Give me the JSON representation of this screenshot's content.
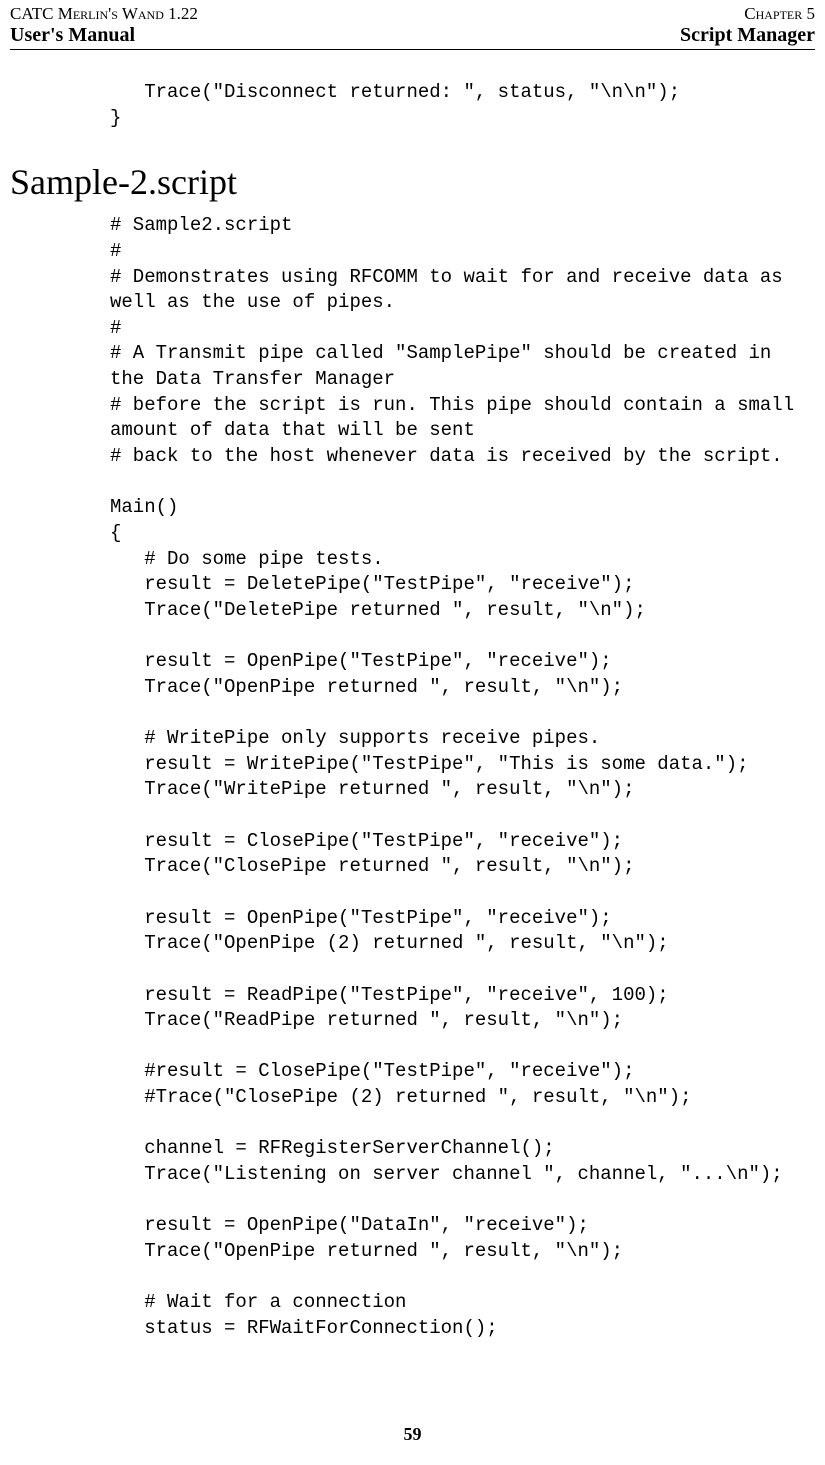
{
  "header": {
    "topLeft": "CATC Merlin's Wand 1.22",
    "topRight": "Chapter 5",
    "bottomLeft": "User's Manual",
    "bottomRight": "Script Manager"
  },
  "codeTop": "   Trace(\"Disconnect returned: \", status, \"\\n\\n\");\n}",
  "heading": "Sample-2.script",
  "codeMain": "# Sample2.script\n#\n# Demonstrates using RFCOMM to wait for and receive data as\nwell as the use of pipes.\n#\n# A Transmit pipe called \"SamplePipe\" should be created in\nthe Data Transfer Manager\n# before the script is run. This pipe should contain a small\namount of data that will be sent\n# back to the host whenever data is received by the script.\n\nMain()\n{\n   # Do some pipe tests.\n   result = DeletePipe(\"TestPipe\", \"receive\");\n   Trace(\"DeletePipe returned \", result, \"\\n\");\n\n   result = OpenPipe(\"TestPipe\", \"receive\");\n   Trace(\"OpenPipe returned \", result, \"\\n\");\n\n   # WritePipe only supports receive pipes.\n   result = WritePipe(\"TestPipe\", \"This is some data.\");\n   Trace(\"WritePipe returned \", result, \"\\n\");\n\n   result = ClosePipe(\"TestPipe\", \"receive\");\n   Trace(\"ClosePipe returned \", result, \"\\n\");\n\n   result = OpenPipe(\"TestPipe\", \"receive\");\n   Trace(\"OpenPipe (2) returned \", result, \"\\n\");\n\n   result = ReadPipe(\"TestPipe\", \"receive\", 100);\n   Trace(\"ReadPipe returned \", result, \"\\n\");\n\n   #result = ClosePipe(\"TestPipe\", \"receive\");\n   #Trace(\"ClosePipe (2) returned \", result, \"\\n\");\n\n   channel = RFRegisterServerChannel();\n   Trace(\"Listening on server channel \", channel, \"...\\n\");\n\n   result = OpenPipe(\"DataIn\", \"receive\");\n   Trace(\"OpenPipe returned \", result, \"\\n\");\n\n   # Wait for a connection\n   status = RFWaitForConnection();",
  "pageNumber": "59"
}
